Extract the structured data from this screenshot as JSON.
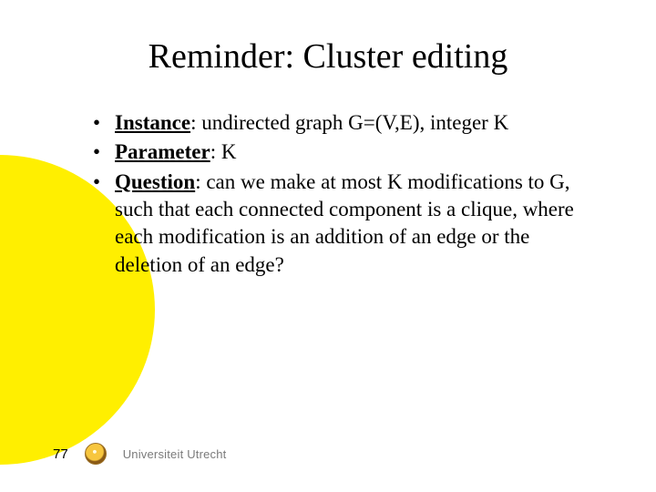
{
  "title": "Reminder: Cluster editing",
  "bullets": [
    {
      "strong": "Instance",
      "rest": ": undirected graph G=(V,E), integer K"
    },
    {
      "strong": "Parameter",
      "rest": ": K"
    },
    {
      "strong": "Question",
      "rest": ": can we make at most K modifications to G, such that each connected component is a clique, where each modification is an addition of an edge or the deletion of an edge?"
    }
  ],
  "footer": {
    "page_number": "77",
    "institution": "Universiteit Utrecht"
  }
}
